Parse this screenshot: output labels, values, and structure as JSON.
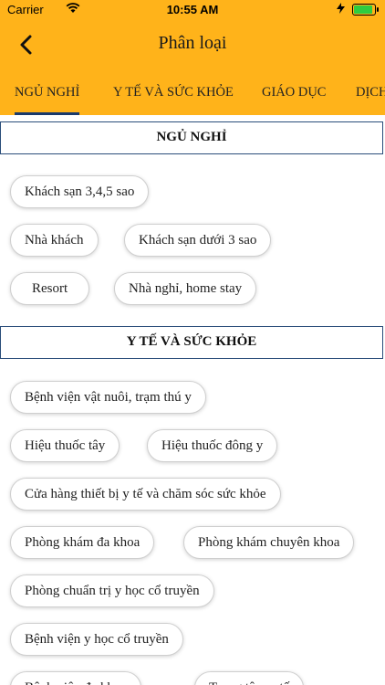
{
  "status_bar": {
    "carrier": "Carrier",
    "time": "10:55 AM"
  },
  "nav": {
    "title": "Phân loại"
  },
  "tabs": [
    {
      "label": "NGỦ NGHỈ",
      "active": true
    },
    {
      "label": "Y TẾ VÀ SỨC KHỎE",
      "active": false
    },
    {
      "label": "GIÁO DỤC",
      "active": false
    },
    {
      "label": "DỊCH",
      "active": false
    }
  ],
  "sections": [
    {
      "title": "NGỦ NGHỈ",
      "items": [
        "Khách sạn 3,4,5 sao",
        "Nhà khách",
        "Khách sạn dưới 3 sao",
        "Resort",
        "Nhà nghỉ, home stay"
      ]
    },
    {
      "title": "Y TẾ VÀ SỨC KHỎE",
      "items": [
        "Bệnh viện vật nuôi, trạm thú y",
        "Hiệu thuốc tây",
        "Hiệu thuốc đông y",
        "Cửa hàng thiết bị y tế và chăm sóc sức khỏe",
        "Phòng khám đa khoa",
        "Phòng khám chuyên khoa",
        "Phòng chuẩn trị y học cổ truyền",
        "Bệnh viện y học cổ truyền",
        "Bệnh viện đa khoa",
        "Trung tâm y tế"
      ]
    }
  ],
  "colors": {
    "header_bg": "#ffb31a",
    "tab_indicator": "#1a3a6b",
    "section_border": "#2a4d7a"
  }
}
